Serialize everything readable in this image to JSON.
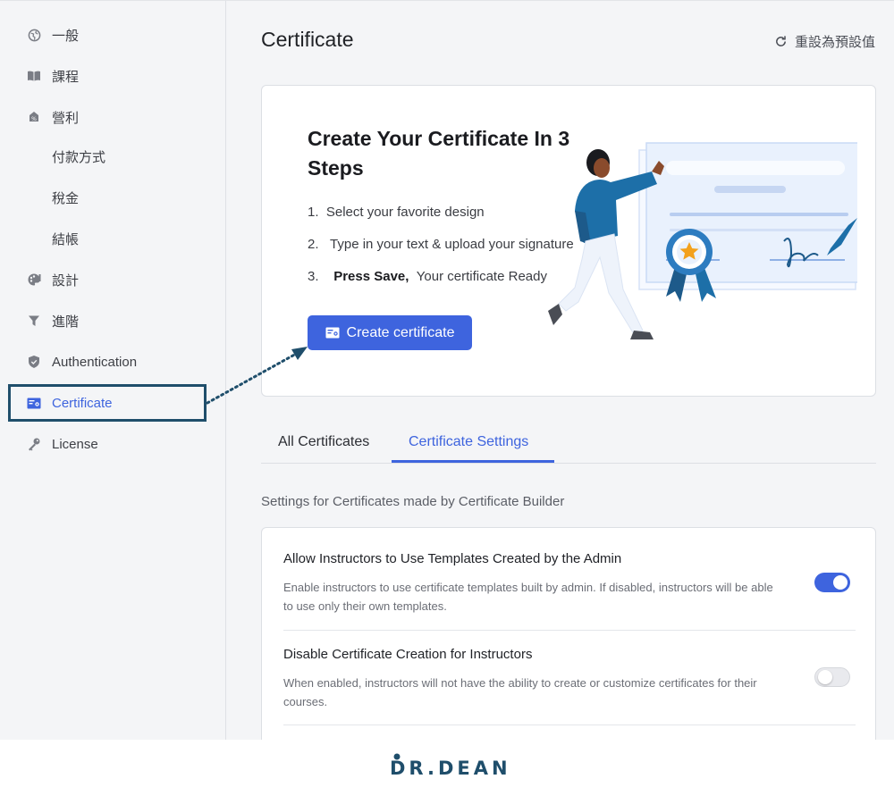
{
  "sidebar": {
    "items": [
      {
        "label": "一般",
        "icon": "globe-icon"
      },
      {
        "label": "課程",
        "icon": "book-icon"
      },
      {
        "label": "營利",
        "icon": "monetization-icon"
      },
      {
        "label": "付款方式"
      },
      {
        "label": "稅金"
      },
      {
        "label": "結帳"
      },
      {
        "label": "設計",
        "icon": "palette-icon"
      },
      {
        "label": "進階",
        "icon": "filter-icon"
      },
      {
        "label": "Authentication",
        "icon": "shield-icon"
      },
      {
        "label": "Certificate",
        "icon": "certificate-icon",
        "active": true
      },
      {
        "label": "License",
        "icon": "key-icon"
      }
    ]
  },
  "header": {
    "title": "Certificate",
    "reset_label": "重設為預設值"
  },
  "hero": {
    "heading": "Create Your Certificate In 3 Steps",
    "steps": [
      {
        "num": "1.",
        "text": "Select your favorite design"
      },
      {
        "num": "2.",
        "text": "Type in your text & upload your signature"
      },
      {
        "num": "3.",
        "bold": "Press Save,",
        "text": "Your certificate Ready"
      }
    ],
    "cta_label": "Create certificate"
  },
  "tabs": [
    {
      "label": "All Certificates",
      "selected": false
    },
    {
      "label": "Certificate Settings",
      "selected": true
    }
  ],
  "settings": {
    "intro": "Settings for Certificates made by Certificate Builder",
    "options": [
      {
        "title": "Allow Instructors to Use Templates Created by the Admin",
        "description": "Enable instructors to use certificate templates built by admin. If disabled, instructors will be able to use only their own templates.",
        "enabled": true
      },
      {
        "title": "Disable Certificate Creation for Instructors",
        "description": "When enabled, instructors will not have the ability to create or customize certificates for their courses.",
        "enabled": false
      }
    ]
  },
  "footer": {
    "logo_text": "DR.DEAN"
  },
  "colors": {
    "accent": "#3e64de",
    "annotation": "#1f4e6b",
    "sidebar_bg": "#f4f5f7"
  }
}
